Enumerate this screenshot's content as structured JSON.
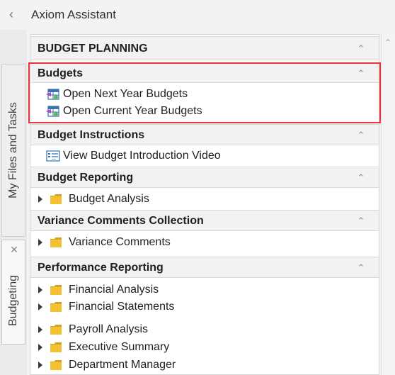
{
  "header": {
    "back_icon": "chevron-left-icon",
    "title": "Axiom Assistant"
  },
  "side_tabs": {
    "files_tab": "My Files and Tasks",
    "budgeting_tab": "Budgeting",
    "close_icon": "close-icon"
  },
  "sections": {
    "budget_planning": {
      "title": "BUDGET PLANNING"
    },
    "budgets": {
      "title": "Budgets",
      "items": [
        {
          "label": "Open Next Year Budgets",
          "icon": "budget-grid-icon"
        },
        {
          "label": "Open Current Year Budgets",
          "icon": "budget-grid-icon"
        }
      ]
    },
    "budget_instructions": {
      "title": "Budget Instructions",
      "items": [
        {
          "label": "View Budget Introduction Video",
          "icon": "video-icon"
        }
      ]
    },
    "budget_reporting": {
      "title": "Budget Reporting",
      "items": [
        {
          "label": "Budget Analysis",
          "icon": "folder-icon"
        }
      ]
    },
    "variance_comments": {
      "title": "Variance Comments Collection",
      "items": [
        {
          "label": "Variance Comments",
          "icon": "folder-icon"
        }
      ]
    },
    "performance_reporting": {
      "title": "Performance Reporting",
      "items": [
        {
          "label": "Financial Analysis",
          "icon": "folder-icon"
        },
        {
          "label": "Financial Statements",
          "icon": "folder-icon"
        },
        {
          "label": "Payroll Analysis",
          "icon": "folder-icon"
        },
        {
          "label": "Executive Summary",
          "icon": "folder-icon"
        },
        {
          "label": "Department Manager",
          "icon": "folder-icon"
        }
      ]
    }
  },
  "colors": {
    "highlight_border": "#e8343b",
    "folder_yellow": "#f2c230",
    "header_bg": "#f2f2f2"
  }
}
